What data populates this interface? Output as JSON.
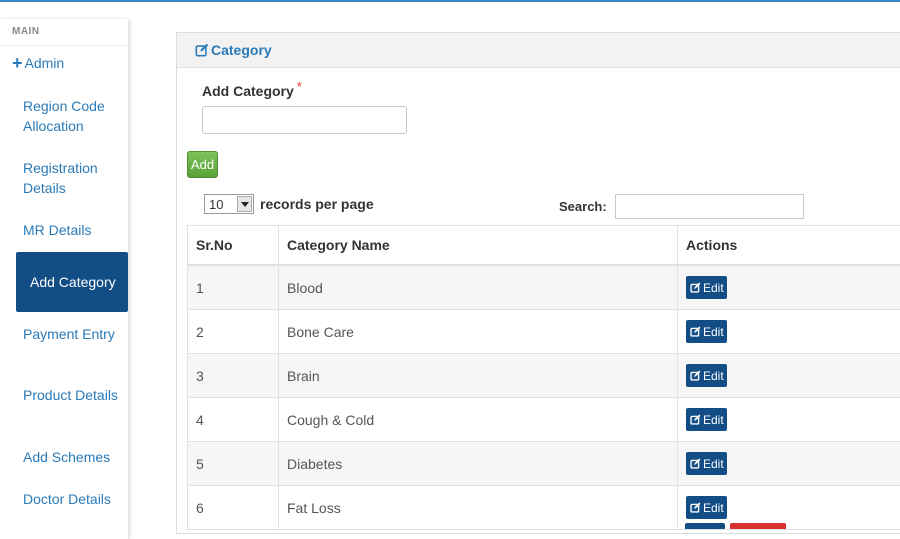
{
  "sidebar": {
    "header": "MAIN",
    "admin_label": "Admin",
    "items": [
      {
        "label": "Region Code Allocation"
      },
      {
        "label": "Registration Details"
      },
      {
        "label": "MR Details"
      },
      {
        "label": "Add Category",
        "active": true
      },
      {
        "label": "Payment Entry"
      },
      {
        "label": "Product Details"
      },
      {
        "label": "Add Schemes"
      },
      {
        "label": "Doctor Details"
      }
    ]
  },
  "panel": {
    "title": "Category",
    "field_label": "Add Category",
    "required_mark": "*",
    "input_value": "",
    "add_button": "Add",
    "records_per_page": {
      "value": "10",
      "label": "records per page"
    },
    "search_label": "Search:",
    "search_value": ""
  },
  "table": {
    "columns": [
      "Sr.No",
      "Category Name",
      "Actions"
    ],
    "rows": [
      {
        "sr": "1",
        "name": "Blood",
        "action": "Edit"
      },
      {
        "sr": "2",
        "name": "Bone Care",
        "action": "Edit"
      },
      {
        "sr": "3",
        "name": "Brain",
        "action": "Edit"
      },
      {
        "sr": "4",
        "name": "Cough & Cold",
        "action": "Edit"
      },
      {
        "sr": "5",
        "name": "Diabetes",
        "action": "Edit"
      },
      {
        "sr": "6",
        "name": "Fat Loss",
        "action": "Edit"
      }
    ]
  },
  "colors": {
    "accent": "#2b7ab7",
    "active_bg": "#134d86",
    "add_button": "#6ab447",
    "delete_button": "#d9302c"
  },
  "icons": {
    "admin": "plus-icon",
    "panel_title": "edit-square-icon",
    "edit_button": "edit-square-icon"
  }
}
